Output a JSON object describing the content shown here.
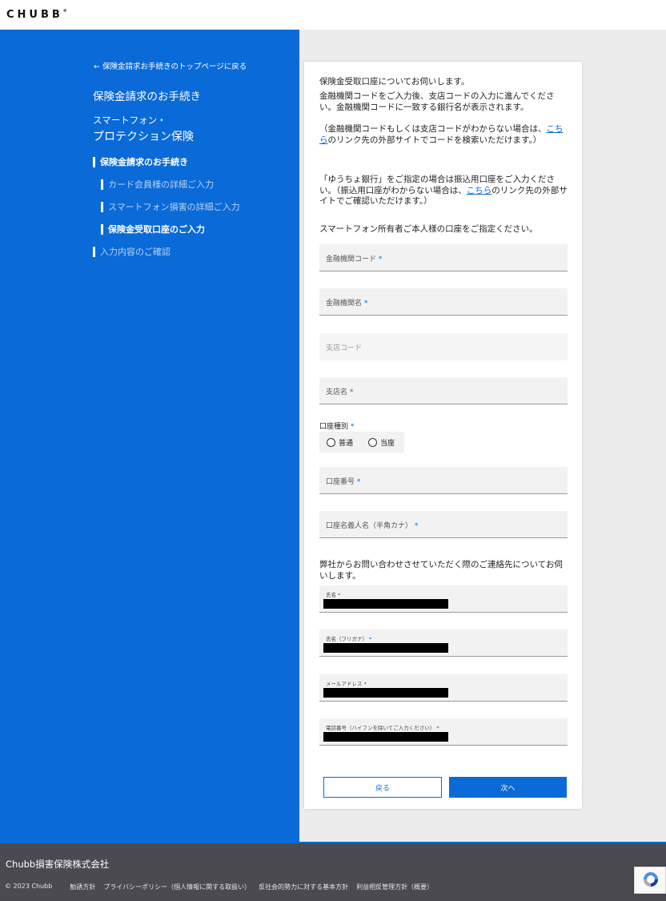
{
  "header": {
    "logo_text": "CHUBB",
    "logo_mark": "®"
  },
  "sidebar": {
    "back_link": "← 保険金請求お手続きのトップページに戻る",
    "title": "保険金請求のお手続き",
    "product_line1": "スマートフォン・",
    "product_line2": "プロテクション保険",
    "steps": [
      {
        "label": "保険金請求のお手続き",
        "state": "active"
      },
      {
        "label": "カード会員様の詳細ご入力",
        "state": "dim"
      },
      {
        "label": "スマートフォン損害の詳細ご入力",
        "state": "dim"
      },
      {
        "label": "保険金受取口座のご入力",
        "state": "active"
      },
      {
        "label": "入力内容のご確認",
        "state": "dim"
      }
    ]
  },
  "form": {
    "intro": "保険金受取口座についてお伺いします。",
    "instruction_a": "金融機関コードをご入力後、支店コードの入力に進んでください。金融機関コードに一致する銀行名が表示されます。",
    "instruction_b_pre": "（金融機関コードもしくは支店コードがわからない場合は、",
    "instruction_b_link": "こちら",
    "instruction_b_post": "のリンク先の外部サイトでコードを検索いただけます。）",
    "yucho_pre": "「ゆうちょ銀行」をご指定の場合は振込用口座をご入力ください。（振込用口座がわからない場合は、",
    "yucho_link": "こちら",
    "yucho_post": "のリンク先の外部サイトでご確認いただけます。）",
    "owner_note": "スマートフォン所有者ご本人様の口座をご指定ください。",
    "fields": {
      "bank_code": "金融機関コード",
      "bank_name": "金融機関名",
      "branch_code": "支店コード",
      "branch_name": "支店名",
      "account_number": "口座番号",
      "account_holder": "口座名義人名（半角カナ）"
    },
    "required_mark": "*",
    "account_type_label": "口座種別",
    "account_type_options": [
      "普通",
      "当座"
    ],
    "contact_note": "弊社からお問い合わせさせていただく際のご連絡先についてお伺いします。",
    "contact_fields": {
      "name": "氏名",
      "name_kana": "氏名（フリガナ）",
      "email": "メールアドレス",
      "phone": "電話番号（ハイフンを除いてご入力ください）"
    },
    "back_button": "戻る",
    "next_button": "次へ"
  },
  "footer": {
    "company": "Chubb損害保険株式会社",
    "copyright": "© 2023 Chubb",
    "links": [
      "勧誘方針",
      "プライバシーポリシー（個人情報に関する取扱い）",
      "反社会的勢力に対する基本方針",
      "利益相反管理方針（概要）"
    ]
  },
  "colors": {
    "brand_blue": "#0a6ad8",
    "footer_bg": "#4a4a50"
  }
}
